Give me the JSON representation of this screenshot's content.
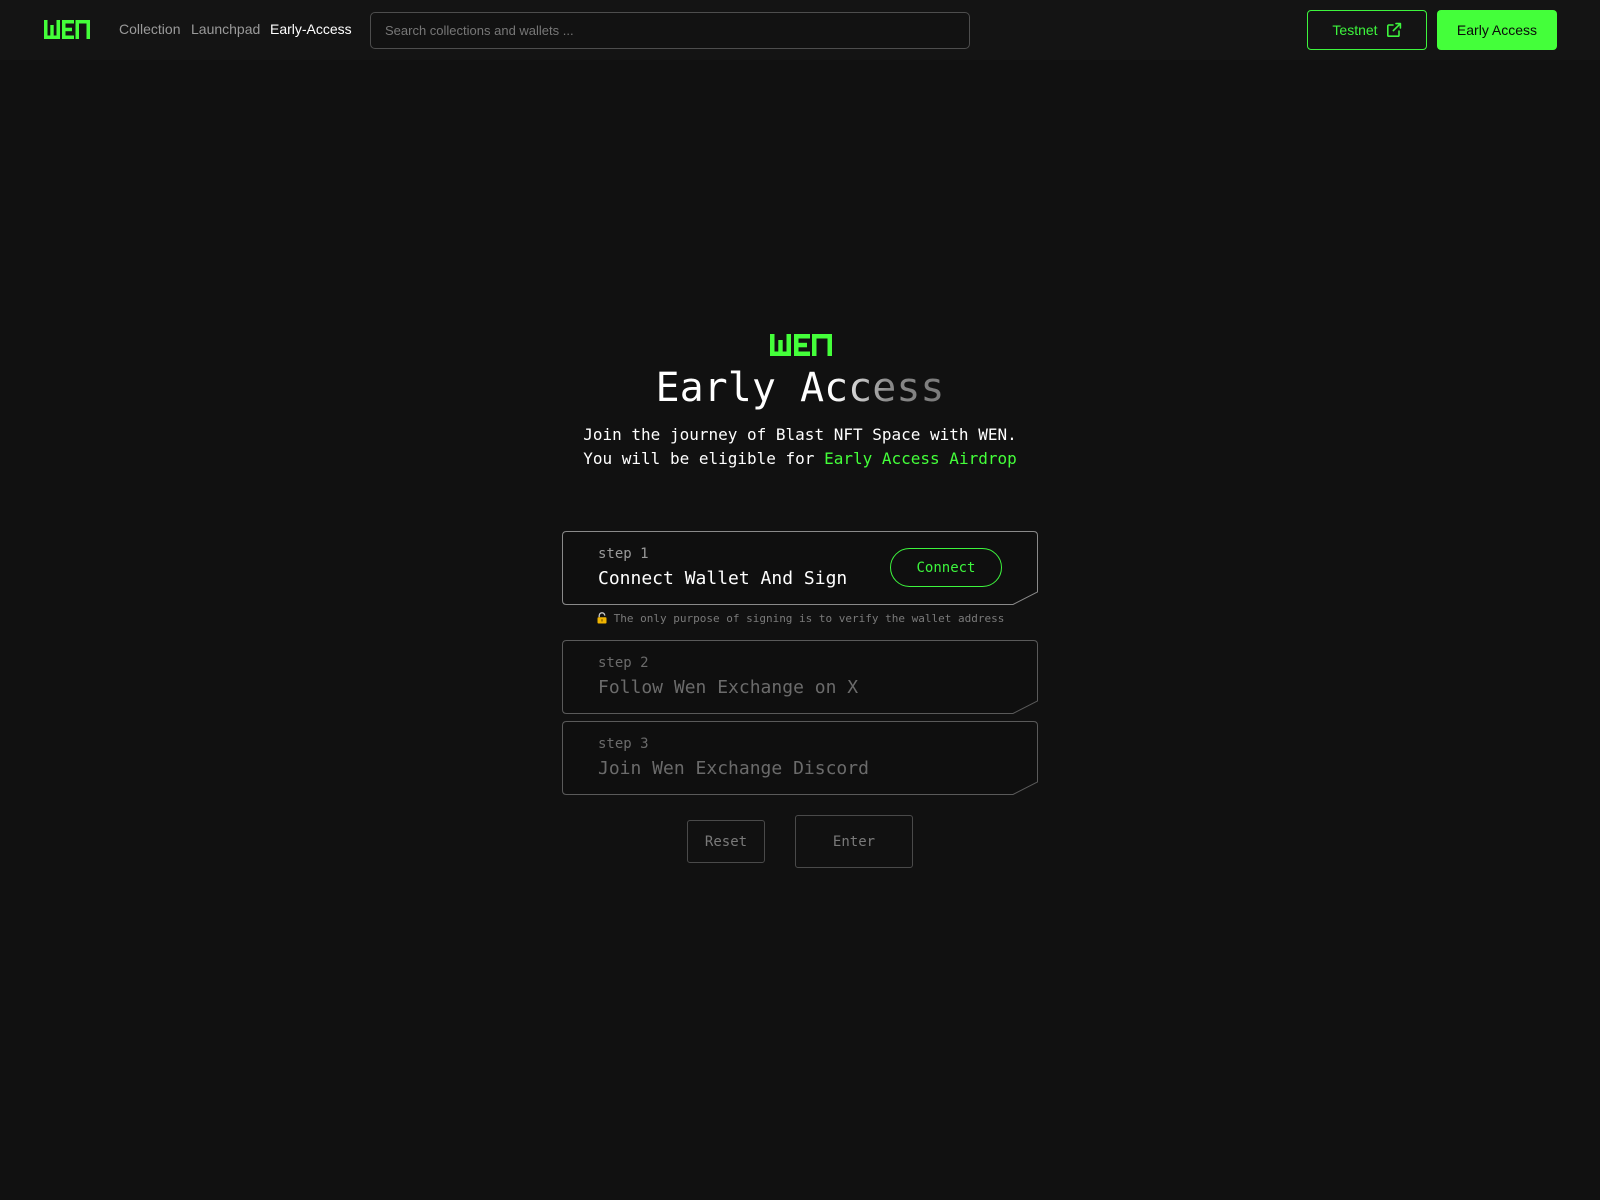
{
  "header": {
    "logo_text": "WEN",
    "nav": [
      {
        "label": "Collection",
        "active": false
      },
      {
        "label": "Launchpad",
        "active": false
      },
      {
        "label": "Early-Access",
        "active": true
      }
    ],
    "search": {
      "placeholder": "Search collections and wallets ...",
      "value": ""
    },
    "testnet_label": "Testnet",
    "early_access_label": "Early Access"
  },
  "hero": {
    "logo_text": "WEN",
    "title": "Early Access",
    "subtitle_line1": "Join the journey of Blast NFT Space with WEN.",
    "subtitle_line2_prefix": "You will be eligible for ",
    "subtitle_line2_accent": "Early Access Airdrop"
  },
  "steps": [
    {
      "label": "step 1",
      "title": "Connect Wallet And Sign",
      "action_label": "Connect",
      "enabled": true
    },
    {
      "label": "step 2",
      "title": "Follow Wen Exchange on X",
      "enabled": false
    },
    {
      "label": "step 3",
      "title": "Join Wen Exchange Discord",
      "enabled": false
    }
  ],
  "sign_note": "The only purpose of signing is to verify the wallet address",
  "actions": {
    "reset_label": "Reset",
    "enter_label": "Enter"
  },
  "colors": {
    "accent": "#44ff3a",
    "background": "#111111",
    "header_bg": "#141414"
  },
  "icons": {
    "logo": "wen-logo-icon",
    "testnet": "external-link-icon",
    "note": "lock-icon"
  }
}
